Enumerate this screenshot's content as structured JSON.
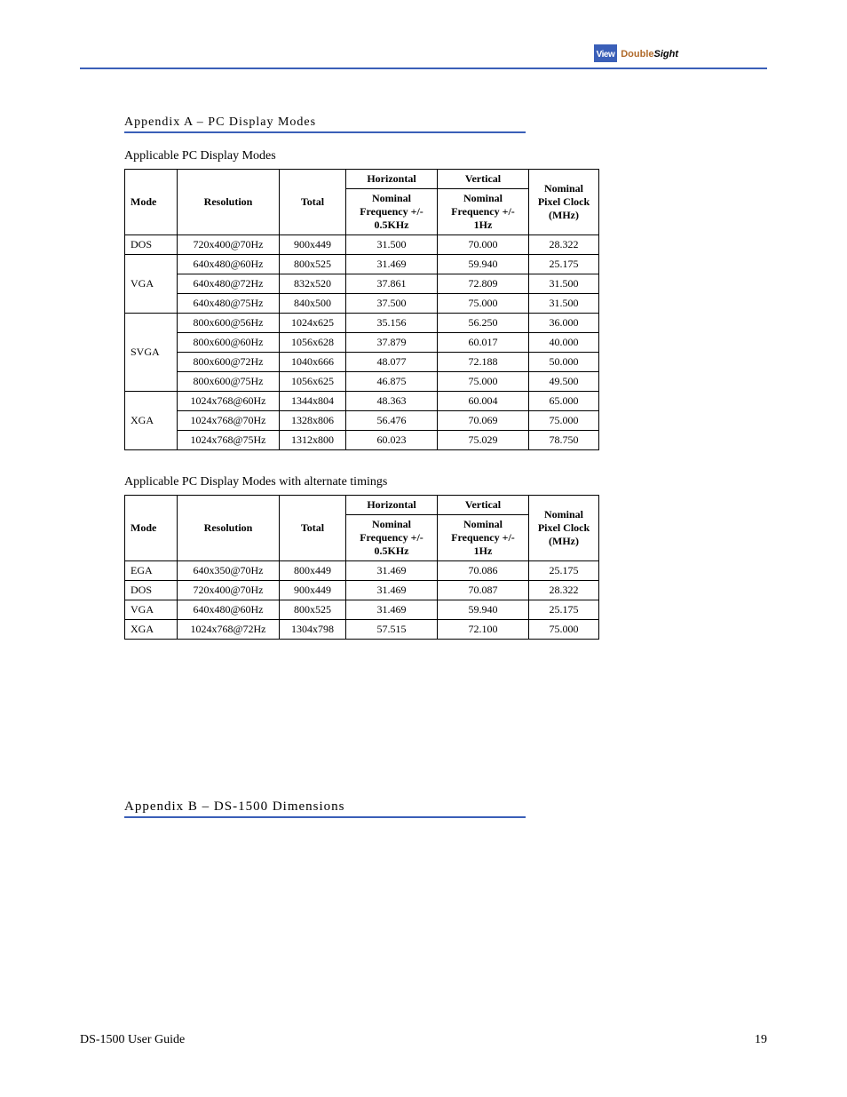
{
  "logo": {
    "box": "View",
    "w1": "Double",
    "w2": "Sight"
  },
  "section_title": "Appendix A – PC Display Modes",
  "table1_caption": "Applicable PC Display Modes",
  "table2_caption": "Applicable PC Display Modes with alternate timings",
  "th": {
    "mode": "Mode",
    "res": "Resolution",
    "total": "Total",
    "h": "Horizontal",
    "v": "Vertical",
    "hnom": "Nominal Frequency +/- 0.5KHz",
    "vnom": "Nominal Frequency +/- 1Hz",
    "clk": "Nominal Pixel Clock (MHz)"
  },
  "t1": {
    "g0": {
      "mode": "DOS",
      "rows": [
        {
          "res": "720x400@70Hz",
          "tot": "900x449",
          "h": "31.500",
          "v": "70.000",
          "c": "28.322"
        }
      ]
    },
    "g1": {
      "mode": "VGA",
      "rows": [
        {
          "res": "640x480@60Hz",
          "tot": "800x525",
          "h": "31.469",
          "v": "59.940",
          "c": "25.175"
        },
        {
          "res": "640x480@72Hz",
          "tot": "832x520",
          "h": "37.861",
          "v": "72.809",
          "c": "31.500"
        },
        {
          "res": "640x480@75Hz",
          "tot": "840x500",
          "h": "37.500",
          "v": "75.000",
          "c": "31.500"
        }
      ]
    },
    "g2": {
      "mode": "SVGA",
      "rows": [
        {
          "res": "800x600@56Hz",
          "tot": "1024x625",
          "h": "35.156",
          "v": "56.250",
          "c": "36.000"
        },
        {
          "res": "800x600@60Hz",
          "tot": "1056x628",
          "h": "37.879",
          "v": "60.017",
          "c": "40.000"
        },
        {
          "res": "800x600@72Hz",
          "tot": "1040x666",
          "h": "48.077",
          "v": "72.188",
          "c": "50.000"
        },
        {
          "res": "800x600@75Hz",
          "tot": "1056x625",
          "h": "46.875",
          "v": "75.000",
          "c": "49.500"
        }
      ]
    },
    "g3": {
      "mode": "XGA",
      "rows": [
        {
          "res": "1024x768@60Hz",
          "tot": "1344x804",
          "h": "48.363",
          "v": "60.004",
          "c": "65.000"
        },
        {
          "res": "1024x768@70Hz",
          "tot": "1328x806",
          "h": "56.476",
          "v": "70.069",
          "c": "75.000"
        },
        {
          "res": "1024x768@75Hz",
          "tot": "1312x800",
          "h": "60.023",
          "v": "75.029",
          "c": "78.750"
        }
      ]
    }
  },
  "t2": [
    {
      "mode": "EGA",
      "res": "640x350@70Hz",
      "tot": "800x449",
      "h": "31.469",
      "v": "70.086",
      "c": "25.175"
    },
    {
      "mode": "DOS",
      "res": "720x400@70Hz",
      "tot": "900x449",
      "h": "31.469",
      "v": "70.087",
      "c": "28.322"
    },
    {
      "mode": "VGA",
      "res": "640x480@60Hz",
      "tot": "800x525",
      "h": "31.469",
      "v": "59.940",
      "c": "25.175"
    },
    {
      "mode": "XGA",
      "res": "1024x768@72Hz",
      "tot": "1304x798",
      "h": "57.515",
      "v": "72.100",
      "c": "75.000"
    }
  ],
  "chapter_title": "Appendix B – DS-1500 Dimensions",
  "footer": {
    "doc": "DS-1500 User Guide",
    "page": "19"
  }
}
